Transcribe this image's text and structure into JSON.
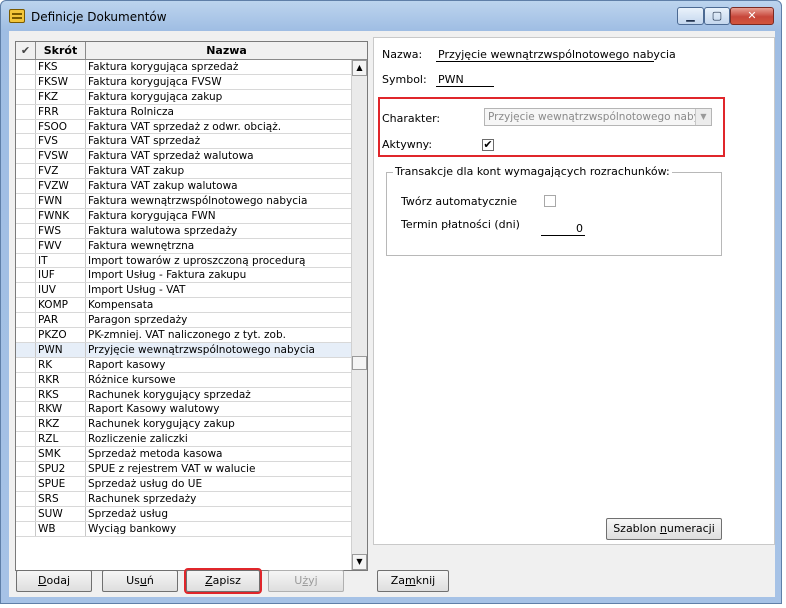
{
  "window": {
    "title": "Definicje Dokumentów",
    "controls": {
      "minimize": "▁",
      "maximize": "▢",
      "close": "✕"
    }
  },
  "list": {
    "headers": {
      "check": "✔",
      "abbr": "Skrót",
      "name": "Nazwa"
    },
    "selected_index": 19,
    "rows": [
      {
        "abbr": "FKS",
        "name": "Faktura korygująca sprzedaż"
      },
      {
        "abbr": "FKSW",
        "name": "Faktura korygująca FVSW"
      },
      {
        "abbr": "FKZ",
        "name": "Faktura korygująca zakup"
      },
      {
        "abbr": "FRR",
        "name": "Faktura Rolnicza"
      },
      {
        "abbr": "FSOO",
        "name": "Faktura VAT sprzedaż z odwr. obciąż."
      },
      {
        "abbr": "FVS",
        "name": "Faktura VAT sprzedaż"
      },
      {
        "abbr": "FVSW",
        "name": "Faktura VAT sprzedaż walutowa"
      },
      {
        "abbr": "FVZ",
        "name": "Faktura VAT zakup"
      },
      {
        "abbr": "FVZW",
        "name": "Faktura VAT zakup walutowa"
      },
      {
        "abbr": "FWN",
        "name": "Faktura wewnątrzwspólnotowego nabycia"
      },
      {
        "abbr": "FWNK",
        "name": "Faktura korygująca FWN"
      },
      {
        "abbr": "FWS",
        "name": "Faktura walutowa sprzedaży"
      },
      {
        "abbr": "FWV",
        "name": "Faktura wewnętrzna"
      },
      {
        "abbr": "IT",
        "name": "Import towarów z uproszczoną procedurą"
      },
      {
        "abbr": "IUF",
        "name": "Import Usług - Faktura zakupu"
      },
      {
        "abbr": "IUV",
        "name": "Import Usług - VAT"
      },
      {
        "abbr": "KOMP",
        "name": "Kompensata"
      },
      {
        "abbr": "PAR",
        "name": "Paragon sprzedaży"
      },
      {
        "abbr": "PKZO",
        "name": "PK-zmniej. VAT naliczonego z tyt. zob."
      },
      {
        "abbr": "PWN",
        "name": "Przyjęcie wewnątrzwspólnotowego nabycia"
      },
      {
        "abbr": "RK",
        "name": "Raport kasowy"
      },
      {
        "abbr": "RKR",
        "name": "Różnice kursowe"
      },
      {
        "abbr": "RKS",
        "name": "Rachunek korygujący sprzedaż"
      },
      {
        "abbr": "RKW",
        "name": "Raport Kasowy walutowy"
      },
      {
        "abbr": "RKZ",
        "name": "Rachunek korygujący zakup"
      },
      {
        "abbr": "RZL",
        "name": "Rozliczenie zaliczki"
      },
      {
        "abbr": "SMK",
        "name": "Sprzedaż metoda kasowa"
      },
      {
        "abbr": "SPU2",
        "name": "SPUE z rejestrem VAT w walucie"
      },
      {
        "abbr": "SPUE",
        "name": "Sprzedaż usług do UE"
      },
      {
        "abbr": "SRS",
        "name": "Rachunek sprzedaży"
      },
      {
        "abbr": "SUW",
        "name": "Sprzedaż usług"
      },
      {
        "abbr": "WB",
        "name": "Wyciąg bankowy"
      }
    ]
  },
  "details": {
    "name_label": "Nazwa:",
    "name_value": "Przyjęcie wewnątrzwspólnotowego nabycia",
    "symbol_label": "Symbol:",
    "symbol_value": "PWN",
    "character_label": "Charakter:",
    "character_value": "Przyjęcie wewnątrzwspólnotowego nabycia",
    "active_label": "Aktywny:",
    "active_checked": "✔",
    "group_title": "Transakcje dla kont wymagających rozrachunków:",
    "auto_label": "Twórz automatycznie",
    "term_label": "Termin płatności (dni)",
    "term_value": "0",
    "numbering_button": {
      "pre": "Szablon ",
      "ul": "n",
      "post": "umeracji"
    }
  },
  "buttons": {
    "add": {
      "ul": "D",
      "post": "odaj"
    },
    "delete": {
      "pre": "Us",
      "ul": "u",
      "post": "ń"
    },
    "save": {
      "ul": "Z",
      "post": "apisz"
    },
    "use": {
      "pre": "U",
      "ul": "ż",
      "post": "yj"
    },
    "close": {
      "pre": "Za",
      "ul": "m",
      "post": "knij"
    }
  }
}
